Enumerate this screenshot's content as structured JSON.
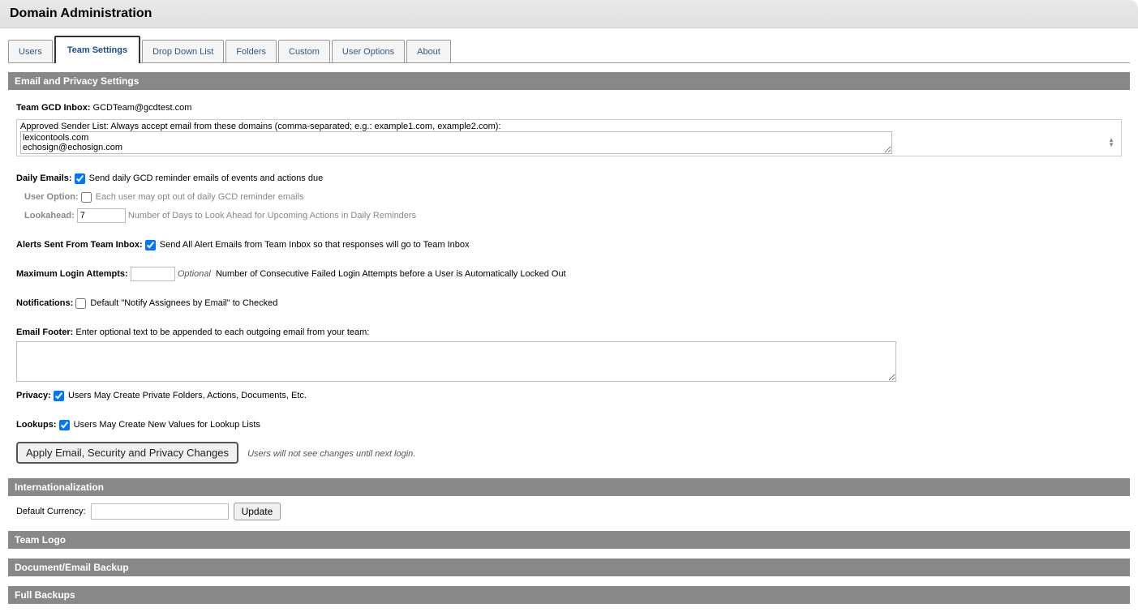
{
  "header": {
    "title": "Domain Administration"
  },
  "tabs": [
    {
      "label": "Users"
    },
    {
      "label": "Team Settings",
      "active": true
    },
    {
      "label": "Drop Down List"
    },
    {
      "label": "Folders"
    },
    {
      "label": "Custom"
    },
    {
      "label": "User Options"
    },
    {
      "label": "About"
    }
  ],
  "email_privacy": {
    "section_title": "Email and Privacy Settings",
    "team_inbox_label": "Team GCD Inbox:",
    "team_inbox_value": "GCDTeam@gcdtest.com",
    "approved_label": "Approved Sender List:",
    "approved_desc": "Always accept email from these domains (comma-separated; e.g.: example1.com, example2.com):",
    "approved_value": "lexicontools.com\nechosign@echosign.com",
    "daily_label": "Daily Emails:",
    "daily_desc": "Send daily GCD reminder emails of events and actions due",
    "user_option_label": "User Option:",
    "user_option_desc": "Each user may opt out of daily GCD reminder emails",
    "lookahead_label": "Lookahead:",
    "lookahead_value": "7",
    "lookahead_desc": "Number of Days to Look Ahead for Upcoming Actions in Daily Reminders",
    "alerts_label": "Alerts Sent From Team Inbox:",
    "alerts_desc": "Send All Alert Emails from Team Inbox so that responses will go to Team Inbox",
    "max_login_label": "Maximum Login Attempts:",
    "max_login_value": "",
    "max_login_optional": "Optional",
    "max_login_desc": "Number of Consecutive Failed Login Attempts before a User is Automatically Locked Out",
    "notifications_label": "Notifications:",
    "notifications_desc": "Default \"Notify Assignees by Email\" to Checked",
    "footer_label": "Email Footer:",
    "footer_desc": "Enter optional text to be appended to each outgoing email from your team:",
    "footer_value": "",
    "privacy_label": "Privacy:",
    "privacy_desc": "Users May Create Private Folders, Actions, Documents, Etc.",
    "lookups_label": "Lookups:",
    "lookups_desc": "Users May Create New Values for Lookup Lists",
    "apply_button": "Apply Email, Security and Privacy Changes",
    "apply_note": "Users will not see changes until next login."
  },
  "intl": {
    "section_title": "Internationalization",
    "currency_label": "Default Currency:",
    "currency_value": "",
    "update_button": "Update"
  },
  "team_logo": {
    "section_title": "Team Logo"
  },
  "doc_backup": {
    "section_title": "Document/Email Backup"
  },
  "full_backups": {
    "section_title": "Full Backups"
  }
}
